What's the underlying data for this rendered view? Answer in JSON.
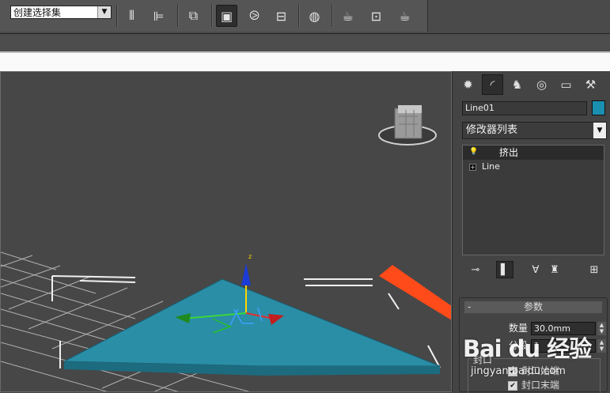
{
  "toolbar": {
    "selection_set_label": "创建选择集",
    "icons": [
      "mirror-icon",
      "align-icon",
      "layer-manager-icon",
      "scene-explorer-icon",
      "curve-editor-icon",
      "schematic-view-icon",
      "material-editor-icon",
      "render-setup-icon",
      "render-frame-icon",
      "render-icon"
    ]
  },
  "command_panel": {
    "tabs": [
      "create-icon",
      "modify-icon",
      "hierarchy-icon",
      "motion-icon",
      "display-icon",
      "utilities-icon"
    ],
    "active_tab": "modify",
    "object_name": "Line01",
    "object_color": "#1a8fb0",
    "modifier_list_label": "修改器列表",
    "stack": [
      {
        "label": "挤出",
        "selected": true,
        "icon": "lightbulb-icon"
      },
      {
        "label": "Line",
        "selected": false,
        "icon": "expand-plus-icon"
      }
    ],
    "stack_tools": [
      "pin-stack-icon",
      "show-end-result-icon",
      "make-unique-icon",
      "remove-modifier-icon",
      "configure-modifier-sets-icon"
    ]
  },
  "parameters": {
    "rollout_title": "参数",
    "amount_label": "数量",
    "amount_value": "30.0mm",
    "segments_label": "分段",
    "segments_value": "1",
    "capping_label": "封口",
    "cap_start_label": "封口始端",
    "cap_end_label": "封口末端",
    "cap_start_checked": true,
    "cap_end_checked": true
  },
  "viewport": {
    "gizmo_axes": [
      "x",
      "y",
      "z"
    ],
    "z_axis_label": "z",
    "shape_color": "#2a8ea6",
    "annotation_arrow_color": "#ff4a1a"
  },
  "watermark": {
    "logo": "Bai du 经验",
    "url": "jingyan.baidu.com"
  }
}
